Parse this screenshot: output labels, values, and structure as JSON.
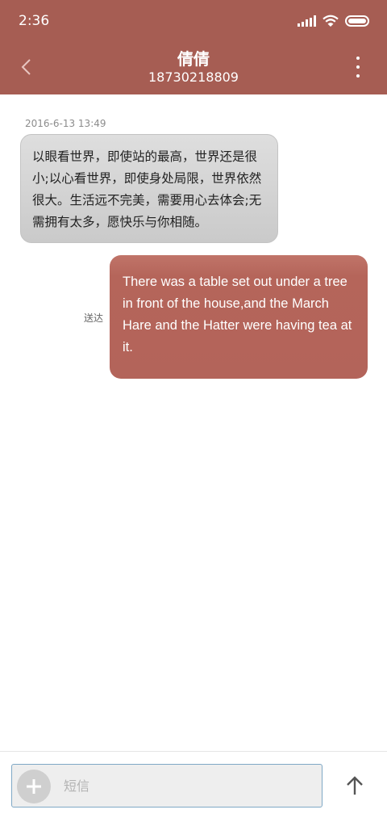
{
  "status_bar": {
    "time": "2:36",
    "icons": [
      "signal-icon",
      "wifi-icon",
      "battery-icon"
    ]
  },
  "header": {
    "contact_name": "倩倩",
    "contact_number": "18730218809",
    "back_icon": "chevron-left-icon",
    "menu_icon": "more-vertical-icon",
    "bar_color": "#a65d53"
  },
  "conversation": {
    "timestamp": "2016-6-13 13:49",
    "messages": [
      {
        "direction": "incoming",
        "text": "以眼看世界，即使站的最高，世界还是很小;以心看世界，即使身处局限，世界依然很大。生活远不完美，需要用心去体会;无需拥有太多，愿快乐与你相随。"
      },
      {
        "direction": "outgoing",
        "text": "There was a table set out under a tree in front of the house,and the March Hare and the Hatter were having tea at it.",
        "status": "送达",
        "bubble_color": "#b3645a"
      }
    ]
  },
  "composer": {
    "placeholder": "短信",
    "value": "",
    "add_icon": "plus-icon",
    "send_icon": "arrow-up-icon"
  }
}
